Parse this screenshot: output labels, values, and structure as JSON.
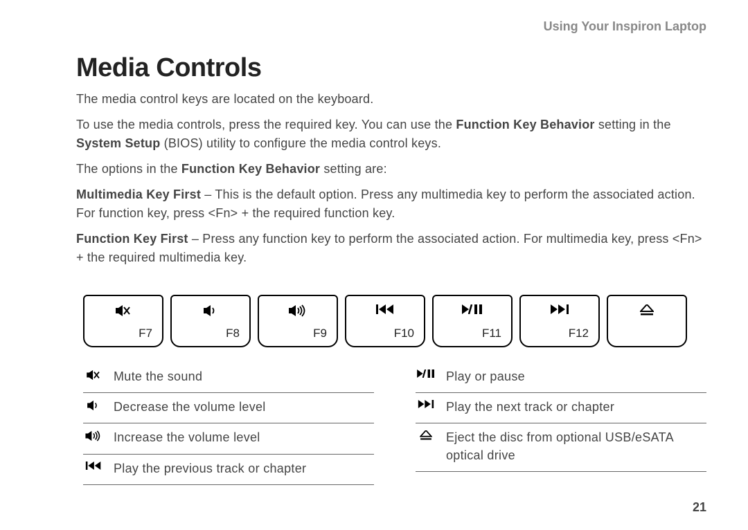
{
  "header": "Using Your Inspiron Laptop",
  "title": "Media Controls",
  "p1": "The media control keys are located on the keyboard.",
  "p2a": "To use the media controls, press the required key. You can use the ",
  "p2b": "Function Key Behavior",
  "p2c": " setting in the ",
  "p2d": "System Setup",
  "p2e": " (BIOS) utility to configure the media control keys.",
  "p3a": "The options in the ",
  "p3b": "Function Key Behavior",
  "p3c": " setting are:",
  "p4a": "Multimedia Key First",
  "p4b": " – This is the default option. Press any multimedia key to perform the associated action. For function key, press <Fn> + the required function key.",
  "p5a": "Function Key First",
  "p5b": " – Press any function key to perform the associated action. For multimedia key, press <Fn> + the required multimedia key.",
  "keys": [
    {
      "fn": "F7",
      "icon": "mute"
    },
    {
      "fn": "F8",
      "icon": "voldown"
    },
    {
      "fn": "F9",
      "icon": "volup"
    },
    {
      "fn": "F10",
      "icon": "prev"
    },
    {
      "fn": "F11",
      "icon": "playpause"
    },
    {
      "fn": "F12",
      "icon": "next"
    },
    {
      "fn": "",
      "icon": "eject"
    }
  ],
  "legend_left": [
    {
      "icon": "mute",
      "text": "Mute the sound"
    },
    {
      "icon": "voldown",
      "text": "Decrease the volume level"
    },
    {
      "icon": "volup",
      "text": "Increase the volume level"
    },
    {
      "icon": "prev",
      "text": "Play the previous track or chapter"
    }
  ],
  "legend_right": [
    {
      "icon": "playpause",
      "text": "Play or pause"
    },
    {
      "icon": "next",
      "text": "Play the next track or chapter"
    },
    {
      "icon": "eject",
      "text": "Eject the disc from optional USB/eSATA optical drive"
    }
  ],
  "page": "21"
}
